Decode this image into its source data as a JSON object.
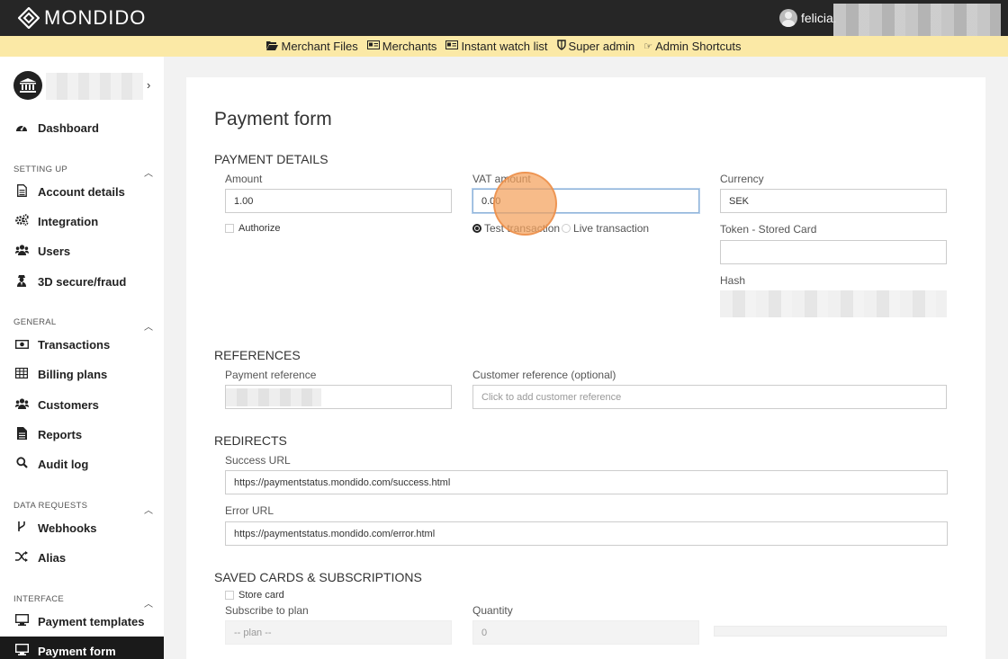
{
  "brand": {
    "name": "MONDIDO"
  },
  "user": {
    "name": "felicia."
  },
  "admin_bar": [
    {
      "label": "Merchant Files",
      "icon": "folder-open-icon",
      "glyph": "📂"
    },
    {
      "label": "Merchants",
      "icon": "id-card-icon",
      "glyph": "▤"
    },
    {
      "label": "Instant watch list",
      "icon": "id-card-icon",
      "glyph": "▤"
    },
    {
      "label": "Super admin",
      "icon": "shield-icon",
      "glyph": "⛉"
    },
    {
      "label": "Admin Shortcuts",
      "icon": "hand-pointer-icon",
      "glyph": "☞"
    }
  ],
  "sidebar": {
    "dashboard": "Dashboard",
    "sections": {
      "setting_up": "SETTING UP",
      "general": "GENERAL",
      "data_requests": "DATA REQUESTS",
      "interface": "INTERFACE"
    },
    "items": {
      "account_details": "Account details",
      "integration": "Integration",
      "users": "Users",
      "secure_fraud": "3D secure/fraud",
      "transactions": "Transactions",
      "billing_plans": "Billing plans",
      "customers": "Customers",
      "reports": "Reports",
      "audit_log": "Audit log",
      "webhooks": "Webhooks",
      "alias": "Alias",
      "payment_templates": "Payment templates",
      "payment_form": "Payment form"
    },
    "active_item": "Payment form"
  },
  "form": {
    "title": "Payment form",
    "payment_details": {
      "heading": "PAYMENT DETAILS",
      "amount_label": "Amount",
      "amount_value": "1.00",
      "vat_label": "VAT amount",
      "vat_value": "0.00",
      "currency_label": "Currency",
      "currency_value": "SEK",
      "authorize_label": "Authorize",
      "test_transaction": "Test transaction",
      "live_transaction": "Live transaction",
      "selected_mode": "Test transaction",
      "token_label": "Token - Stored Card",
      "token_value": "",
      "hash_label": "Hash"
    },
    "references": {
      "heading": "REFERENCES",
      "payment_reference_label": "Payment reference",
      "customer_reference_label": "Customer reference (optional)",
      "customer_reference_placeholder": "Click to add customer reference"
    },
    "redirects": {
      "heading": "REDIRECTS",
      "success_label": "Success URL",
      "success_value": "https://paymentstatus.mondido.com/success.html",
      "error_label": "Error URL",
      "error_value": "https://paymentstatus.mondido.com/error.html"
    },
    "saved_cards": {
      "heading": "SAVED CARDS & SUBSCRIPTIONS",
      "store_card_label": "Store card",
      "subscribe_label": "Subscribe to plan",
      "subscribe_placeholder": "-- plan --",
      "quantity_label": "Quantity",
      "quantity_placeholder": "0"
    }
  }
}
